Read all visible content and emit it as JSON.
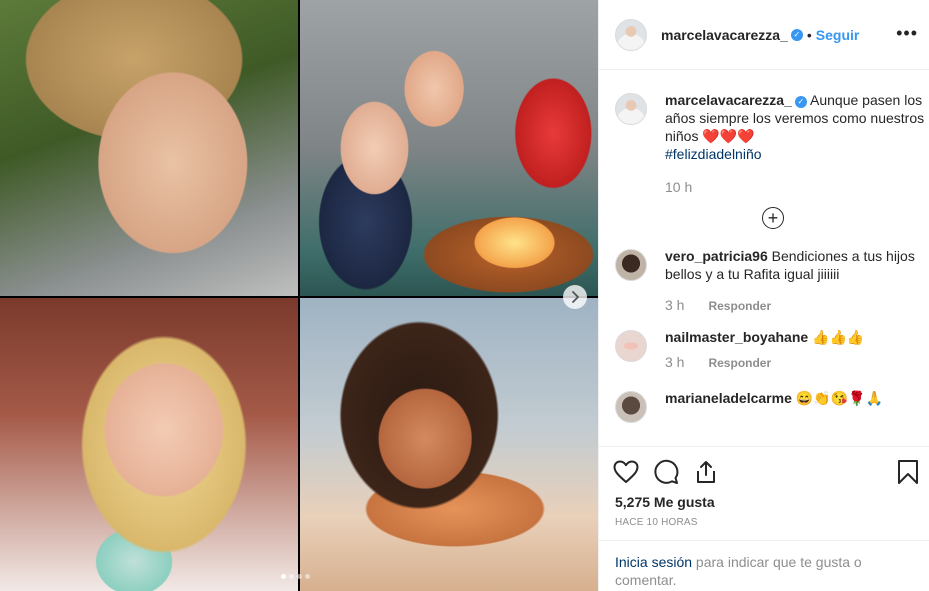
{
  "header": {
    "username": "marcelavacarezza_",
    "separator": "•",
    "follow_label": "Seguir",
    "more_label": "•••"
  },
  "caption": {
    "username": "marcelavacarezza_",
    "text": "Aunque pasen los años siempre los veremos como nuestros niños",
    "hearts": "❤️❤️❤️",
    "hashtag": "#felizdiadelniño",
    "time": "10 h"
  },
  "comments": [
    {
      "username": "vero_patricia96",
      "text": "Bendiciones a tus hijos bellos y a tu Rafita igual jiiiiii",
      "time": "3 h",
      "reply_label": "Responder"
    },
    {
      "username": "nailmaster_boyahane",
      "text": "👍👍👍",
      "time": "3 h",
      "reply_label": "Responder"
    },
    {
      "username": "marianeladelcarme",
      "text": "😄👏😘🌹🙏",
      "time": "",
      "reply_label": ""
    }
  ],
  "actions": {
    "like_icon": "heart-outline",
    "comment_icon": "speech-bubble",
    "share_icon": "share-arrow",
    "save_icon": "bookmark"
  },
  "likes_label": "5,275 Me gusta",
  "posted_time": "HACE 10 HORAS",
  "login": {
    "link_label": "Inicia sesión",
    "rest_text": " para indicar que te gusta o comentar."
  },
  "carousel": {
    "dot_count": 4,
    "active_dot": 0
  }
}
